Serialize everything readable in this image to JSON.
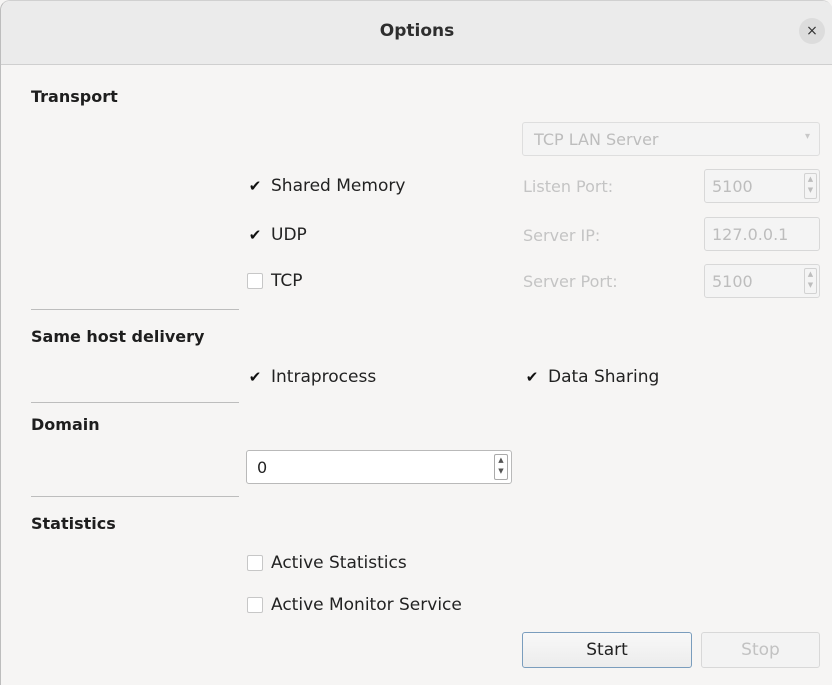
{
  "window": {
    "title": "Options",
    "close_glyph": "×"
  },
  "sections": {
    "transport": "Transport",
    "same_host": "Same host delivery",
    "domain": "Domain",
    "statistics": "Statistics"
  },
  "transport": {
    "shared_memory": {
      "label": "Shared Memory",
      "checked": true
    },
    "udp": {
      "label": "UDP",
      "checked": true
    },
    "tcp": {
      "label": "TCP",
      "checked": false
    },
    "tcp_mode": {
      "value": "TCP LAN Server",
      "enabled": false
    },
    "listen_port": {
      "label": "Listen Port:",
      "value": "5100"
    },
    "server_ip": {
      "label": "Server IP:",
      "value": "127.0.0.1"
    },
    "server_port": {
      "label": "Server Port:",
      "value": "5100"
    }
  },
  "same_host": {
    "intraprocess": {
      "label": "Intraprocess",
      "checked": true
    },
    "data_sharing": {
      "label": "Data Sharing",
      "checked": true
    }
  },
  "domain": {
    "value": "0"
  },
  "statistics": {
    "active_statistics": {
      "label": "Active Statistics",
      "checked": false
    },
    "active_monitor": {
      "label": "Active Monitor Service",
      "checked": false
    }
  },
  "buttons": {
    "start": "Start",
    "stop": "Stop"
  },
  "icons": {
    "check": "✔",
    "spin_up": "▲",
    "spin_down": "▼",
    "combo_arrow": "▾"
  },
  "colors": {
    "disabled_text": "#c4c4c4",
    "start_border": "#7a9dbd"
  }
}
